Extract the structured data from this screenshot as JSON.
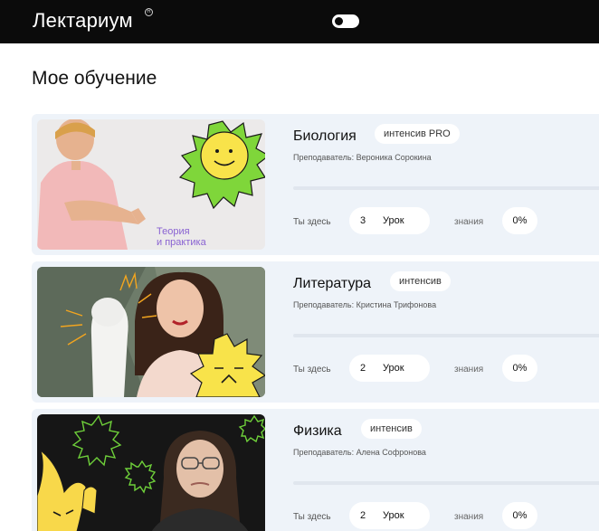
{
  "header": {
    "logo": "Лектариум",
    "registered_mark": "R"
  },
  "page": {
    "title": "Мое обучение"
  },
  "courses": [
    {
      "title": "Биология",
      "badge": "интенсив PRO",
      "teacher": "Преподаватель: Вероника Сорокина",
      "you_here": "Ты здесь",
      "lesson_number": "3",
      "lesson_word": "Урок",
      "knowledge_label": "знания",
      "knowledge_value": "0%",
      "image_caption_line1": "Теория",
      "image_caption_line2": "и практика"
    },
    {
      "title": "Литература",
      "badge": "интенсив",
      "teacher": "Преподаватель: Кристина Трифонова",
      "you_here": "Ты здесь",
      "lesson_number": "2",
      "lesson_word": "Урок",
      "knowledge_label": "знания",
      "knowledge_value": "0%"
    },
    {
      "title": "Физика",
      "badge": "интенсив",
      "teacher": "Преподаватель: Алена Софронова",
      "you_here": "Ты здесь",
      "lesson_number": "2",
      "lesson_word": "Урок",
      "knowledge_label": "знания",
      "knowledge_value": "0%"
    }
  ],
  "colors": {
    "header_bg": "#0b0b0b",
    "card_bg": "#eef3f9",
    "accent_green": "#7fd63a",
    "accent_yellow": "#f8e34a",
    "caption_purple": "#8a63d2"
  }
}
